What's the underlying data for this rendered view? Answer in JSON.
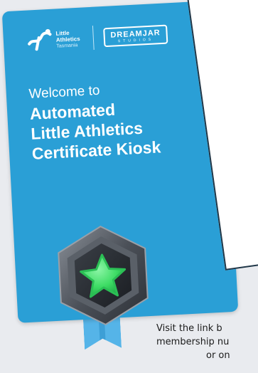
{
  "logos": {
    "little_athletics": {
      "line1": "Little",
      "line2": "Athletics",
      "line3": "Tasmania"
    },
    "dreamjar": {
      "name": "DREAMJAR",
      "sub": "STUDIOS"
    }
  },
  "card": {
    "welcome": "Welcome to",
    "title_lines": [
      "Automated",
      "Little Athletics",
      "Certificate Kiosk"
    ]
  },
  "footer": {
    "lines": [
      "Visit the link b",
      "membership nu",
      "or on"
    ]
  },
  "colors": {
    "card_blue": "#2a9fd6",
    "star_green": "#3ddc64",
    "panel_border": "#1f3647"
  }
}
